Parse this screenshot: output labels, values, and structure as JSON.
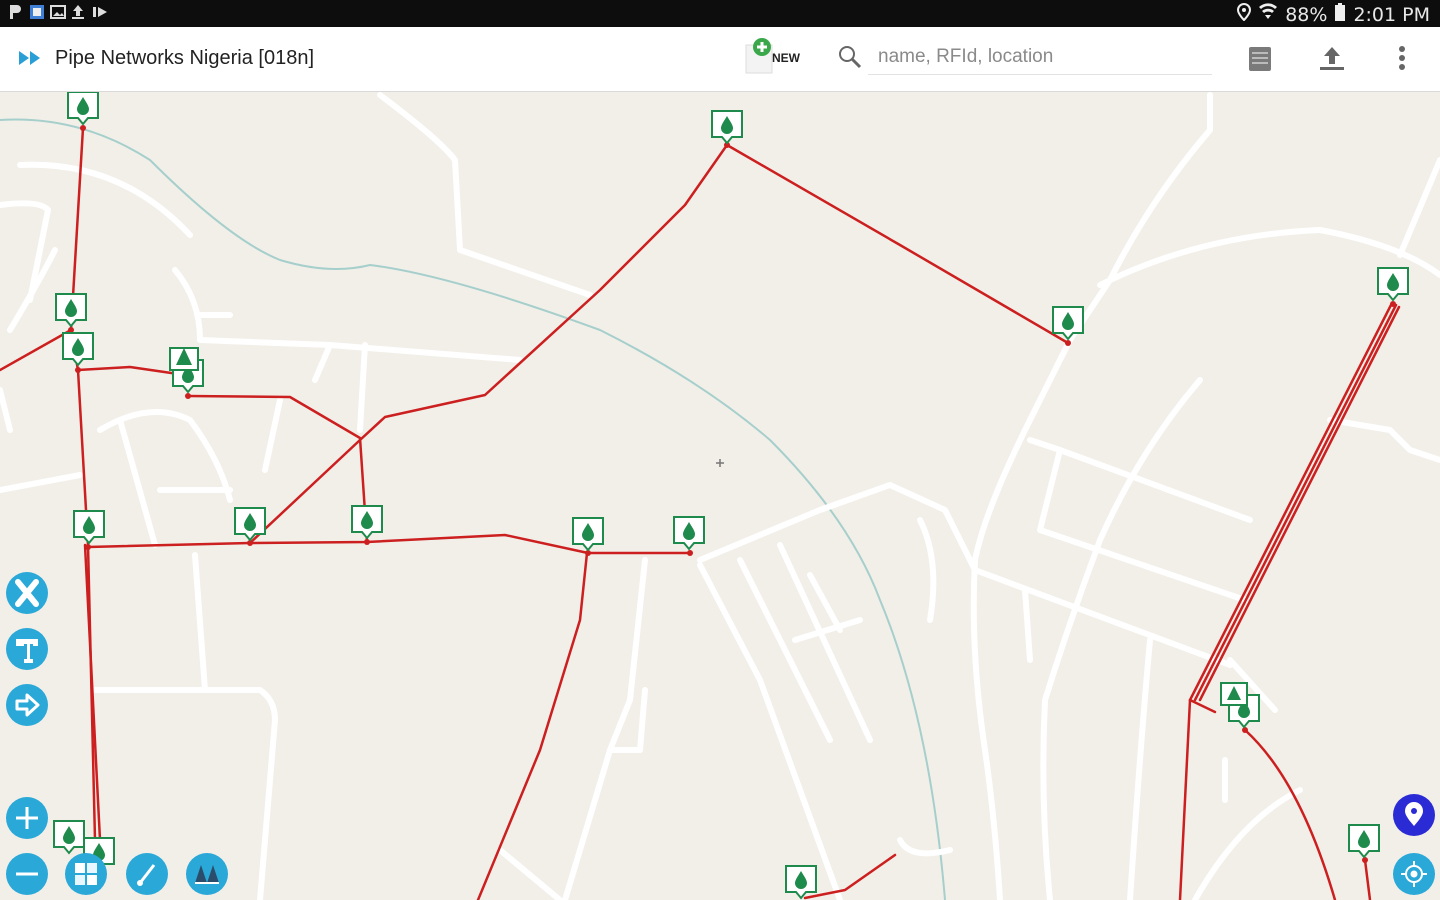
{
  "status_bar": {
    "battery": "88%",
    "time": "2:01 PM"
  },
  "toolbar": {
    "title": "Pipe Networks Nigeria [018n]",
    "new_label": "NEW",
    "search_placeholder": "name, RFId, location"
  },
  "map": {
    "pipe_color": "#cc1f1f",
    "road_color": "#ffffff",
    "background_color": "#f2efe9",
    "river_color": "#a6cfcc",
    "marker_color": "#1e8a4c"
  },
  "map_controls": {
    "accent": "#2aa8d8",
    "left_buttons": [
      "x-tool-icon",
      "text-tool-icon",
      "arrow-right-icon"
    ],
    "bottom_buttons": [
      "zoom-in-icon",
      "zoom-out-icon",
      "layers-icon",
      "measure-icon",
      "basemap-icon"
    ],
    "right_buttons": [
      "marker-location-icon",
      "gps-locate-icon"
    ]
  }
}
